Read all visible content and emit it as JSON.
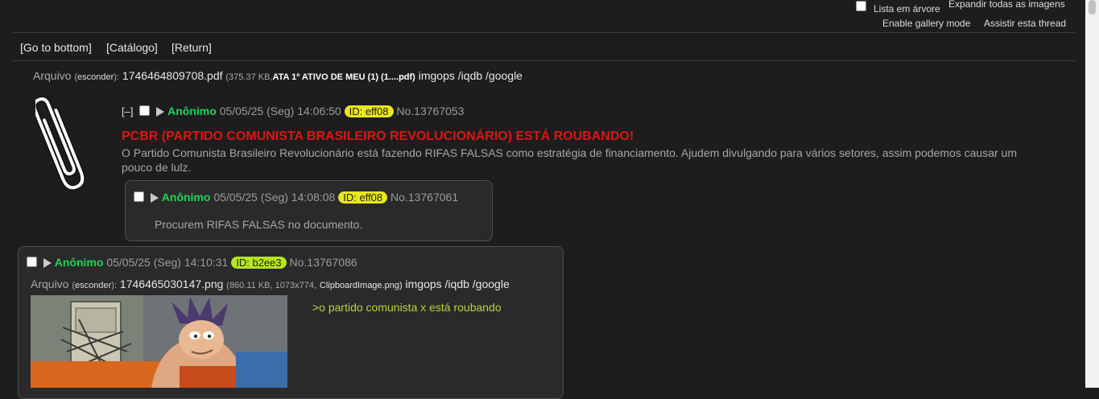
{
  "options": {
    "tree_list_label": "Lista em árvore",
    "expand_images_label": "Expandir todas as imagens",
    "gallery_label": "Enable gallery mode",
    "watch_thread_label": "Assistir esta thread"
  },
  "nav": {
    "go_bottom": "[Go to bottom]",
    "catalog": "[Catálogo]",
    "return": "[Return]"
  },
  "op_file": {
    "label": "Arquivo",
    "hide_open": "(",
    "hide": "esconder",
    "hide_close": "):",
    "filename": "1746464809708.pdf",
    "meta_open": "(375.37 KB,",
    "original_name": "ATA 1º ATIVO DE MEU (1) (1....pdf)",
    "imgops": "imgops",
    "iqdb": "/iqdb",
    "google": "/google"
  },
  "op": {
    "collapse": "[–]",
    "name": "Anônimo",
    "date": "05/05/25 (Seg) 14:06:50",
    "id": "ID: eff08",
    "id_color": "#e8e81a",
    "number": "No.13767053",
    "subject": "PCBR (PARTIDO COMUNISTA BRASILEIRO REVOLUCIONÁRIO) ESTÁ ROUBANDO!",
    "message": "O Partido Comunista Brasileiro Revolucionário está fazendo RIFAS FALSAS como estratégia de financiamento. Ajudem divulgando para vários setores, assim podemos causar um pouco de lulz."
  },
  "reply1": {
    "name": "Anônimo",
    "date": "05/05/25 (Seg) 14:08:08",
    "id": "ID: eff08",
    "id_color": "#e8e81a",
    "number": "No.13767061",
    "message": "Procurem RIFAS FALSAS no documento."
  },
  "reply2": {
    "name": "Anônimo",
    "date": "05/05/25 (Seg) 14:10:31",
    "id": "ID: b2ee3",
    "id_color": "#b5e61d",
    "number": "No.13767086",
    "file_label": "Arquivo",
    "hide_open": "(",
    "hide": "esconder",
    "hide_close": "):",
    "filename": "1746465030147.png",
    "meta": "(860.11 KB, 1073x774,",
    "original_name": "ClipboardImage.png)",
    "imgops": "imgops",
    "iqdb": "/iqdb",
    "google": "/google",
    "message": ">o partido comunista x está roubando"
  }
}
